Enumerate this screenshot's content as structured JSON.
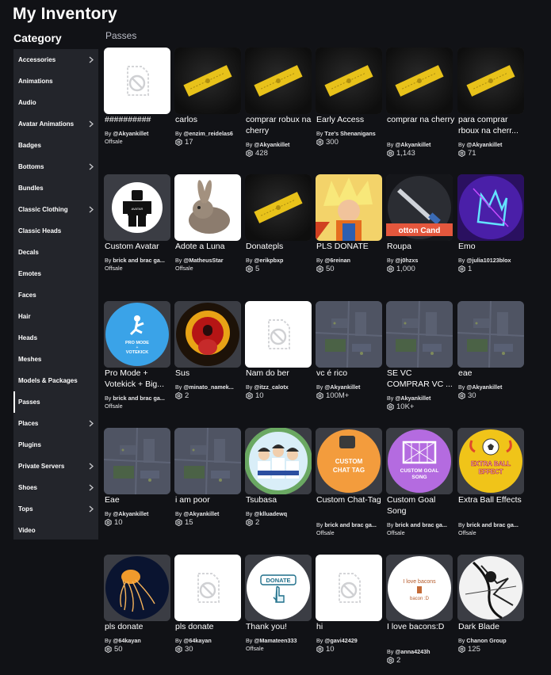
{
  "page_title": "My Inventory",
  "category_title": "Category",
  "section_label": "Passes",
  "sidebar": [
    {
      "label": "Accessories",
      "chevron": true
    },
    {
      "label": "Animations",
      "chevron": false
    },
    {
      "label": "Audio",
      "chevron": false
    },
    {
      "label": "Avatar Animations",
      "chevron": true
    },
    {
      "label": "Badges",
      "chevron": false
    },
    {
      "label": "Bottoms",
      "chevron": true
    },
    {
      "label": "Bundles",
      "chevron": false
    },
    {
      "label": "Classic Clothing",
      "chevron": true
    },
    {
      "label": "Classic Heads",
      "chevron": false
    },
    {
      "label": "Decals",
      "chevron": false
    },
    {
      "label": "Emotes",
      "chevron": false
    },
    {
      "label": "Faces",
      "chevron": false
    },
    {
      "label": "Hair",
      "chevron": false
    },
    {
      "label": "Heads",
      "chevron": false
    },
    {
      "label": "Meshes",
      "chevron": false
    },
    {
      "label": "Models & Packages",
      "chevron": false
    },
    {
      "label": "Passes",
      "chevron": false,
      "active": true
    },
    {
      "label": "Places",
      "chevron": true
    },
    {
      "label": "Plugins",
      "chevron": false
    },
    {
      "label": "Private Servers",
      "chevron": true
    },
    {
      "label": "Shoes",
      "chevron": true
    },
    {
      "label": "Tops",
      "chevron": true
    },
    {
      "label": "Video",
      "chevron": false
    }
  ],
  "items": [
    {
      "name": "##########",
      "creator": "@Akyankillet",
      "price": null,
      "offsale": "Offsale",
      "thumb": "placeholder-white"
    },
    {
      "name": "carlos",
      "creator": "@enzim_reidelas6",
      "price": "17",
      "offsale": null,
      "thumb": "ticket"
    },
    {
      "name": "comprar robux na cherry",
      "creator": "@Akyankillet",
      "price": "428",
      "offsale": null,
      "thumb": "ticket"
    },
    {
      "name": "Early Access",
      "creator": "Tze's Shenanigans",
      "price": "300",
      "offsale": null,
      "thumb": "ticket"
    },
    {
      "name": "comprar na cherry",
      "creator": "@Akyankillet",
      "price": "1,143",
      "offsale": null,
      "thumb": "ticket"
    },
    {
      "name": "para comprar rboux na cherr...",
      "creator": "@Akyankillet",
      "price": "71",
      "offsale": null,
      "thumb": "ticket"
    },
    {
      "name": "Custom Avatar",
      "creator": "brick and brac ga...",
      "price": null,
      "offsale": "Offsale",
      "thumb": "avatar"
    },
    {
      "name": "Adote a Luna",
      "creator": "@MatheusStar",
      "price": null,
      "offsale": "Offsale",
      "thumb": "bunny"
    },
    {
      "name": "Donatepls",
      "creator": "@erikpbxp",
      "price": "5",
      "offsale": null,
      "thumb": "ticket"
    },
    {
      "name": "PLS DONATE",
      "creator": "@6reinan",
      "price": "50",
      "offsale": null,
      "thumb": "goku"
    },
    {
      "name": "Roupa",
      "creator": "@j0hzxs",
      "price": "1,000",
      "offsale": null,
      "thumb": "knife"
    },
    {
      "name": "Emo",
      "creator": "@julia10123blox",
      "price": "1",
      "offsale": null,
      "thumb": "wolf"
    },
    {
      "name": "Pro Mode + Votekick + Big...",
      "creator": "brick and brac ga...",
      "price": null,
      "offsale": "Offsale",
      "thumb": "promode"
    },
    {
      "name": "Sus",
      "creator": "@minato_namek...",
      "price": "2",
      "offsale": null,
      "thumb": "sus"
    },
    {
      "name": "Nam do ber",
      "creator": "@itzz_calotx",
      "price": "10",
      "offsale": null,
      "thumb": "placeholder-white"
    },
    {
      "name": "vc é rico",
      "creator": "@Akyankillet",
      "price": "100M+",
      "offsale": null,
      "thumb": "map"
    },
    {
      "name": "SE VC COMPRAR VC ...",
      "creator": "@Akyankillet",
      "price": "10K+",
      "offsale": null,
      "thumb": "map"
    },
    {
      "name": "eae",
      "creator": "@Akyankillet",
      "price": "30",
      "offsale": null,
      "thumb": "map"
    },
    {
      "name": "Eae",
      "creator": "@Akyankillet",
      "price": "10",
      "offsale": null,
      "thumb": "map"
    },
    {
      "name": "i am poor",
      "creator": "@Akyankillet",
      "price": "15",
      "offsale": null,
      "thumb": "map"
    },
    {
      "name": "Tsubasa",
      "creator": "@klluadewq",
      "price": "2",
      "offsale": null,
      "thumb": "tsubasa"
    },
    {
      "name": "Custom Chat-Tag",
      "creator": "brick and brac ga...",
      "price": null,
      "offsale": "Offsale",
      "thumb": "chattag"
    },
    {
      "name": "Custom Goal Song",
      "creator": "brick and brac ga...",
      "price": null,
      "offsale": "Offsale",
      "thumb": "goalsong"
    },
    {
      "name": "Extra Ball Effects",
      "creator": "brick and brac ga...",
      "price": null,
      "offsale": "Offsale",
      "thumb": "ballfx"
    },
    {
      "name": "pls donate",
      "creator": "@64kayan",
      "price": "50",
      "offsale": null,
      "thumb": "jelly"
    },
    {
      "name": "pls donate",
      "creator": "@64kayan",
      "price": "30",
      "offsale": null,
      "thumb": "placeholder-white"
    },
    {
      "name": "Thank you!",
      "creator": "@Mamateen333",
      "price": null,
      "offsale": "Offsale",
      "thumb": "donate"
    },
    {
      "name": "hi",
      "creator": "@gavi42429",
      "price": "10",
      "offsale": null,
      "thumb": "placeholder-white"
    },
    {
      "name": "I love bacons:D",
      "creator": "@anna4243h",
      "price": "2",
      "offsale": null,
      "thumb": "bacon"
    },
    {
      "name": "Dark Blade",
      "creator": "Chanon Group",
      "price": "125",
      "offsale": null,
      "thumb": "blade"
    }
  ],
  "thumb_text": {
    "promode": "PRO MODE + VOTEKICK",
    "chattag": "CUSTOM CHAT TAG",
    "goalsong": "CUSTOM GOAL SONG",
    "ballfx": "EXTRA BALL EFFECT",
    "donate": "DONATE",
    "bacon_1": "I love bacons",
    "bacon_2": "bacon :D",
    "knife": "otton Cand"
  },
  "by_prefix": "By",
  "colors": {
    "background": "#111216",
    "sidebar": "#23252b",
    "card_thumb": "#393b3d",
    "ticket_yellow": "#e8c21a"
  }
}
